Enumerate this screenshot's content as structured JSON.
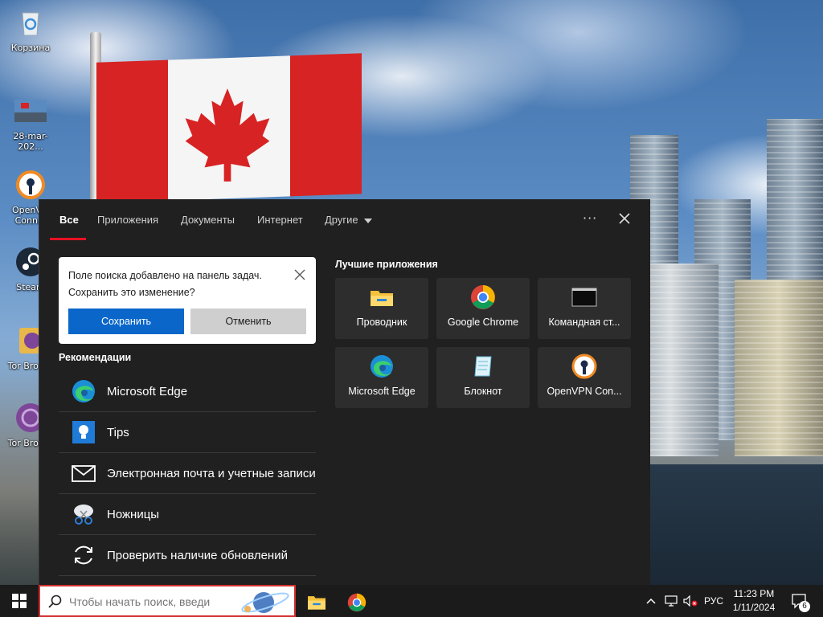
{
  "desktop": {
    "icons": [
      {
        "label": "Корзина",
        "icon": "recycle-bin-icon"
      },
      {
        "label": "28-mar-202...",
        "icon": "photo-icon"
      },
      {
        "label": "OpenV... Conn...",
        "icon": "openvpn-icon"
      },
      {
        "label": "Steam",
        "icon": "steam-icon"
      },
      {
        "label": "Tor Brow...",
        "icon": "tor-browser-icon"
      },
      {
        "label": "Tor Brow...",
        "icon": "tor-browser-icon"
      }
    ]
  },
  "search_panel": {
    "tabs": [
      {
        "label": "Все",
        "active": true
      },
      {
        "label": "Приложения"
      },
      {
        "label": "Документы"
      },
      {
        "label": "Интернет"
      },
      {
        "label": "Другие"
      }
    ],
    "more_label": "···",
    "notice": {
      "text_line1": "Поле поиска добавлено на панель задач.",
      "text_line2": "Сохранить это изменение?",
      "save_label": "Сохранить",
      "cancel_label": "Отменить"
    },
    "recommendations": {
      "title": "Рекомендации",
      "items": [
        {
          "label": "Microsoft Edge",
          "icon": "edge-icon"
        },
        {
          "label": "Tips",
          "icon": "tips-icon"
        },
        {
          "label": "Электронная почта и учетные записи",
          "icon": "mail-icon"
        },
        {
          "label": "Ножницы",
          "icon": "snipping-tool-icon"
        },
        {
          "label": "Проверить наличие обновлений",
          "icon": "update-icon"
        }
      ]
    },
    "top_apps": {
      "title": "Лучшие приложения",
      "items": [
        {
          "label": "Проводник",
          "icon": "file-explorer-icon"
        },
        {
          "label": "Google Chrome",
          "icon": "chrome-icon"
        },
        {
          "label": "Командная ст...",
          "icon": "command-prompt-icon"
        },
        {
          "label": "Microsoft Edge",
          "icon": "edge-icon"
        },
        {
          "label": "Блокнот",
          "icon": "notepad-icon"
        },
        {
          "label": "OpenVPN Con...",
          "icon": "openvpn-icon"
        }
      ]
    }
  },
  "taskbar": {
    "search_placeholder": "Чтобы начать поиск, введи",
    "language": "РУС",
    "time": "11:23 PM",
    "date": "1/11/2024",
    "notification_count": "6"
  }
}
